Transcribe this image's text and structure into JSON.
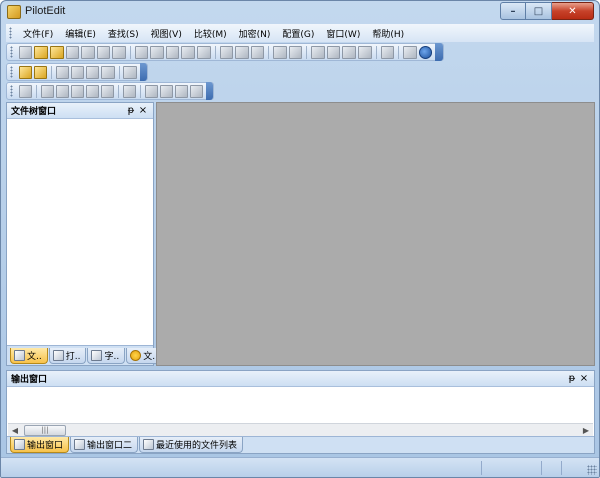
{
  "window": {
    "title": "PilotEdit"
  },
  "menu": {
    "items": [
      "文件(F)",
      "编辑(E)",
      "查找(S)",
      "视图(V)",
      "比较(M)",
      "加密(N)",
      "配置(G)",
      "窗口(W)",
      "帮助(H)"
    ]
  },
  "file_tree_panel": {
    "title": "文件树窗口",
    "tabs": [
      {
        "label": "文..",
        "icon": "folder-tree-icon"
      },
      {
        "label": "打..",
        "icon": "open-document-icon"
      },
      {
        "label": "字..",
        "icon": "font-icon"
      },
      {
        "label": "文..",
        "icon": "star-icon"
      }
    ],
    "active_tab": 0
  },
  "output_panel": {
    "title": "输出窗口",
    "tabs": [
      {
        "label": "输出窗口",
        "icon": "output-icon"
      },
      {
        "label": "输出窗口二",
        "icon": "output-icon"
      },
      {
        "label": "最近使用的文件列表",
        "icon": "recent-files-icon"
      }
    ],
    "active_tab": 0
  },
  "panel_buttons": {
    "pin": "ᵽ",
    "close": "×"
  },
  "scrollbar": {
    "left": "◀",
    "right": "▶",
    "thumb": "|||"
  },
  "window_buttons": {
    "min": "–",
    "max": "□",
    "close": "✕"
  }
}
